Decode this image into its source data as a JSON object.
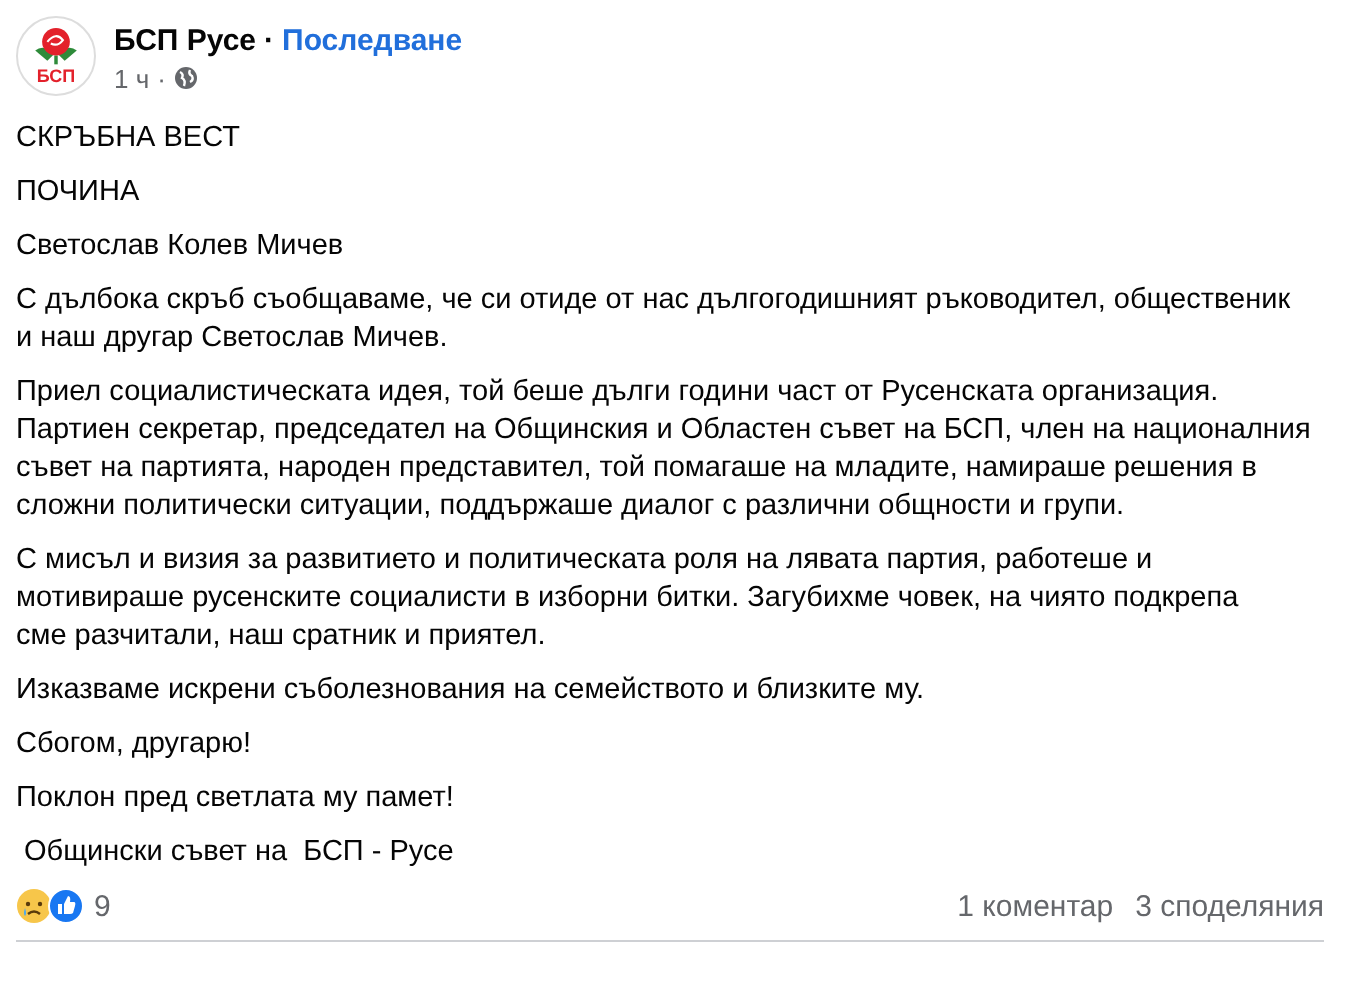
{
  "post": {
    "author": "БСП Русе",
    "separator": "·",
    "follow": "Последване",
    "time": "1 ч",
    "separator_2": "·",
    "logo_text": "БСП",
    "paragraphs": [
      {
        "lines": [
          "СКРЪБНА ВЕСТ"
        ]
      },
      {
        "lines": [
          "ПОЧИНА"
        ]
      },
      {
        "lines": [
          "Светослав Колев Мичев"
        ]
      },
      {
        "lines": [
          "С дълбока скръб съобщаваме, че си отиде от нас дългогодишният ръководител, общественик",
          "и наш другар Светослав Мичев."
        ]
      },
      {
        "lines": [
          "Приел социалистическата идея, той беше дълги години част от Русенската организация.",
          "Партиен секретар, председател на Общинския и Областен съвет на БСП, член на националния",
          "съвет на партията, народен представител, той помагаше на младите, намираше решения в",
          "сложни политически ситуации, поддържаше диалог с различни общности и групи."
        ]
      },
      {
        "lines": [
          "С мисъл и визия за развитието и политическата роля на лявата партия, работеше и",
          "мотивираше русенските социалисти в изборни битки. Загубихме човек, на чиято подкрепа",
          "сме разчитали, наш сратник и приятел."
        ]
      },
      {
        "lines": [
          "Изказваме искрени съболезнования на семейството и близките му."
        ]
      },
      {
        "lines": [
          "Сбогом, другарю!"
        ]
      },
      {
        "lines": [
          "Поклон пред светлата му памет!"
        ]
      },
      {
        "lines": [
          " Общински съвет на  БСП - Русе"
        ]
      }
    ],
    "reactions_count": "9",
    "comments": "1 коментар",
    "shares": "3 споделяния"
  }
}
